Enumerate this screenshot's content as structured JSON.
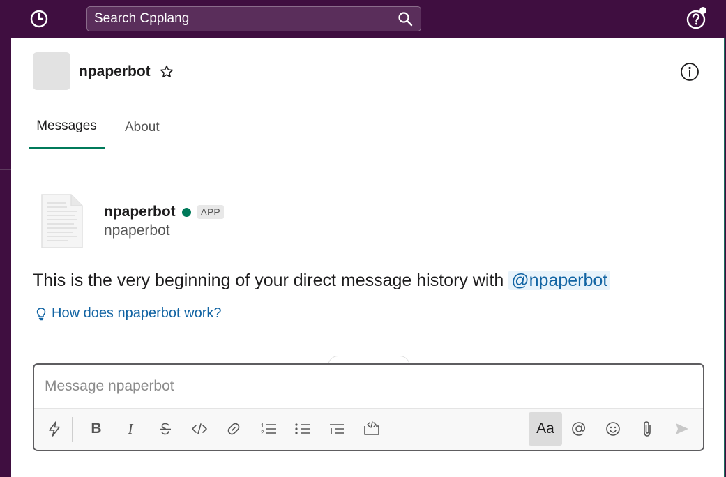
{
  "topbar": {
    "search_placeholder": "Search Cpplang"
  },
  "header": {
    "channel_name": "npaperbot"
  },
  "tabs": [
    {
      "label": "Messages",
      "active": true
    },
    {
      "label": "About",
      "active": false
    }
  ],
  "intro": {
    "bot_name": "npaperbot",
    "badge": "APP",
    "bot_handle": "npaperbot",
    "text": "This is the very beginning of your direct message history with ",
    "mention": "@npaperbot",
    "help_link": "How does npaperbot work?"
  },
  "composer": {
    "placeholder": "Message npaperbot",
    "format_label": "Aa"
  },
  "colors": {
    "sidebar": "#3f0e40",
    "presence": "#007a5a",
    "link": "#1264a3"
  },
  "icons": [
    "history-icon",
    "search-icon",
    "help-icon",
    "star-icon",
    "info-icon",
    "document-icon",
    "lightbulb-icon",
    "shortcuts-icon",
    "bold-icon",
    "italic-icon",
    "strikethrough-icon",
    "code-icon",
    "link-icon",
    "ordered-list-icon",
    "bulleted-list-icon",
    "block-quote-icon",
    "code-block-icon",
    "mention-icon",
    "emoji-icon",
    "attachment-icon",
    "send-icon"
  ]
}
